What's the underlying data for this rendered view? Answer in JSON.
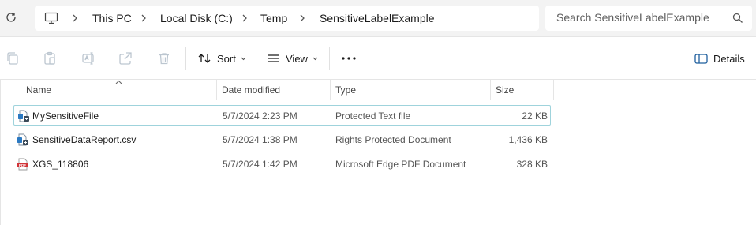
{
  "address_bar": {
    "breadcrumbs": [
      "This PC",
      "Local Disk (C:)",
      "Temp",
      "SensitiveLabelExample"
    ]
  },
  "search": {
    "placeholder": "Search SensitiveLabelExample",
    "value": ""
  },
  "toolbar": {
    "sort_label": "Sort",
    "view_label": "View",
    "details_label": "Details"
  },
  "columns": [
    "Name",
    "Date modified",
    "Type",
    "Size"
  ],
  "files": [
    {
      "name": "MySensitiveFile",
      "date_modified": "5/7/2024 2:23 PM",
      "type": "Protected Text file",
      "size": "22 KB",
      "icon": "protected-text-file-icon",
      "selected": true
    },
    {
      "name": "SensitiveDataReport.csv",
      "date_modified": "5/7/2024 1:38 PM",
      "type": "Rights Protected Document",
      "size": "1,436 KB",
      "icon": "rights-protected-document-icon",
      "selected": false
    },
    {
      "name": "XGS_118806",
      "date_modified": "5/7/2024 1:42 PM",
      "type": "Microsoft Edge PDF Document",
      "size": "328 KB",
      "icon": "pdf-file-icon",
      "selected": false
    }
  ],
  "colors": {
    "selection_border": "#9fd3dc",
    "pdf_red": "#d13438",
    "protected_blue": "#2b79c2",
    "disabled_icon": "#bcc6d0"
  }
}
